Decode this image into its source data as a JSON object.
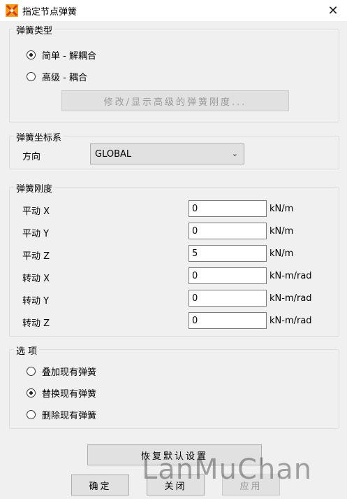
{
  "window": {
    "title": "指定节点弹簧",
    "close_glyph": "✕"
  },
  "spring_type": {
    "legend": "弹簧类型",
    "options": [
      {
        "label": "简单 - 解耦合",
        "checked": true
      },
      {
        "label": "高级 - 耦合",
        "checked": false
      }
    ],
    "advanced_button": "修改/显示高级的弹簧刚度..."
  },
  "coord": {
    "legend": "弹簧坐标系",
    "direction_label": "方向",
    "selected": "GLOBAL",
    "arrow_glyph": "⌄"
  },
  "stiffness": {
    "legend": "弹簧刚度",
    "rows": [
      {
        "label": "平动 X",
        "value": "0",
        "unit": "kN/m"
      },
      {
        "label": "平动 Y",
        "value": "0",
        "unit": "kN/m"
      },
      {
        "label": "平动 Z",
        "value": "5",
        "unit": "kN/m"
      },
      {
        "label": "转动 X",
        "value": "0",
        "unit": "kN-m/rad"
      },
      {
        "label": "转动 Y",
        "value": "0",
        "unit": "kN-m/rad"
      },
      {
        "label": "转动 Z",
        "value": "0",
        "unit": "kN-m/rad"
      }
    ]
  },
  "options": {
    "legend": "选 项",
    "items": [
      {
        "label": "叠加现有弹簧",
        "checked": false
      },
      {
        "label": "替换现有弹簧",
        "checked": true
      },
      {
        "label": "删除现有弹簧",
        "checked": false
      }
    ]
  },
  "buttons": {
    "reset": "恢复默认设置",
    "ok": "确定",
    "close": "关闭",
    "apply": "应用"
  },
  "watermark": "LanMuChan",
  "colors": {
    "window_bg": "#f0f0f0",
    "button_bg": "#e1e1e1",
    "icon_red": "#d23a1e",
    "icon_orange": "#f39c1f"
  }
}
